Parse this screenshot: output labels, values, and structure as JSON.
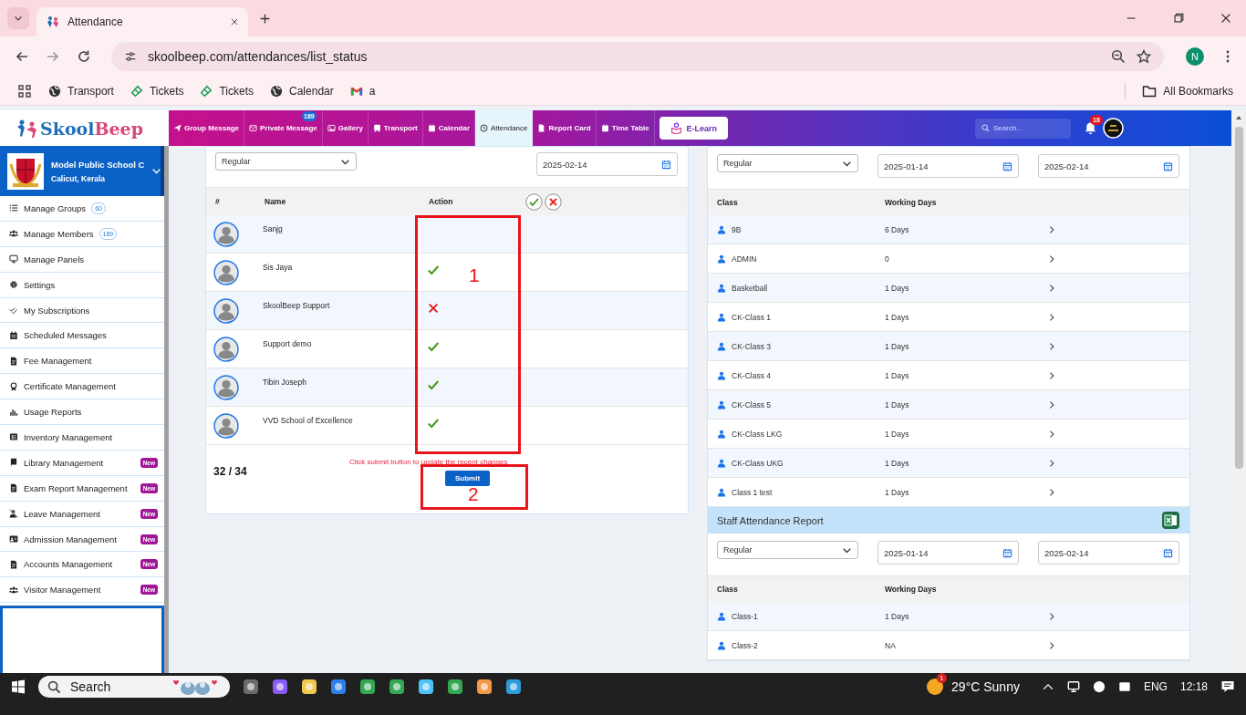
{
  "browser": {
    "tab_title": "Attendance",
    "url": "skoolbeep.com/attendances/list_status",
    "profile": "N",
    "bookmarks": [
      "Transport",
      "Tickets",
      "Tickets",
      "Calendar",
      "a"
    ],
    "all_bookmarks": "All Bookmarks"
  },
  "app": {
    "logo": [
      "Skool",
      "Beep"
    ],
    "nav": [
      {
        "label": "Group Message",
        "selected": false
      },
      {
        "label": "Private Message",
        "selected": false,
        "badge": "189"
      },
      {
        "label": "Gallery",
        "selected": false
      },
      {
        "label": "Transport",
        "selected": false
      },
      {
        "label": "Calendar",
        "selected": false
      },
      {
        "label": "Attendance",
        "selected": true
      },
      {
        "label": "Report Card",
        "selected": false
      },
      {
        "label": "Time Table",
        "selected": false
      }
    ],
    "elearn": "E-Learn",
    "search_placeholder": "Search...",
    "notifications": "18"
  },
  "sidebar": {
    "school_name": "Model Public School C",
    "location": "Calicut, Kerala",
    "items": [
      {
        "label": "Manage Groups",
        "count": "60"
      },
      {
        "label": "Manage Members",
        "count": "189"
      },
      {
        "label": "Manage Panels"
      },
      {
        "label": "Settings"
      },
      {
        "label": "My Subscriptions"
      },
      {
        "label": "Scheduled Messages"
      },
      {
        "label": "Fee Management"
      },
      {
        "label": "Certificate Management"
      },
      {
        "label": "Usage Reports"
      },
      {
        "label": "Inventory Management"
      },
      {
        "label": "Library Management",
        "badge": "New"
      },
      {
        "label": "Exam Report Management",
        "badge": "New"
      },
      {
        "label": "Leave Management",
        "badge": "New"
      },
      {
        "label": "Admission Management",
        "badge": "New"
      },
      {
        "label": "Accounts Management",
        "badge": "New"
      },
      {
        "label": "Visitor Management",
        "badge": "New"
      }
    ]
  },
  "attendance": {
    "type": "Regular",
    "date": "2025-02-14",
    "columns": [
      "#",
      "Name",
      "Action"
    ],
    "rows": [
      {
        "name": "Sanjg",
        "marked": false
      },
      {
        "name": "Sis Jaya",
        "marked": true,
        "present": true
      },
      {
        "name": "SkoolBeep Support",
        "marked": true,
        "present": false
      },
      {
        "name": "Support demo",
        "marked": true,
        "present": true
      },
      {
        "name": "Tibin Joseph",
        "marked": true,
        "present": true
      },
      {
        "name": "VVD School of Excellence",
        "marked": true,
        "present": true
      }
    ],
    "count": "32 / 34",
    "hint": "Click submit button to update the recent changes",
    "submit": "Submit"
  },
  "annotations": [
    "1",
    "2"
  ],
  "class_report": {
    "type": "Regular",
    "from": "2025-01-14",
    "to": "2025-02-14",
    "columns": [
      "Class",
      "Working Days"
    ],
    "rows": [
      {
        "class": "9B",
        "days": "6 Days"
      },
      {
        "class": "ADMIN",
        "days": "0"
      },
      {
        "class": "Basketball",
        "days": "1 Days"
      },
      {
        "class": "CK-Class 1",
        "days": "1 Days"
      },
      {
        "class": "CK-Class 3",
        "days": "1 Days"
      },
      {
        "class": "CK-Class 4",
        "days": "1 Days"
      },
      {
        "class": "CK-Class 5",
        "days": "1 Days"
      },
      {
        "class": "CK-Class LKG",
        "days": "1 Days"
      },
      {
        "class": "CK-Class UKG",
        "days": "1 Days"
      },
      {
        "class": "Class 1 test",
        "days": "1 Days"
      }
    ]
  },
  "staff_report": {
    "title": "Staff Attendance Report",
    "type": "Regular",
    "from": "2025-01-14",
    "to": "2025-02-14",
    "columns": [
      "Class",
      "Working Days"
    ],
    "rows": [
      {
        "class": "Class-1",
        "days": "1 Days"
      },
      {
        "class": "Class-2",
        "days": "NA"
      }
    ]
  },
  "taskbar": {
    "search": "Search",
    "weather": "29°C Sunny",
    "weather_badge": "1",
    "language": "ENG",
    "time": "12:18"
  }
}
